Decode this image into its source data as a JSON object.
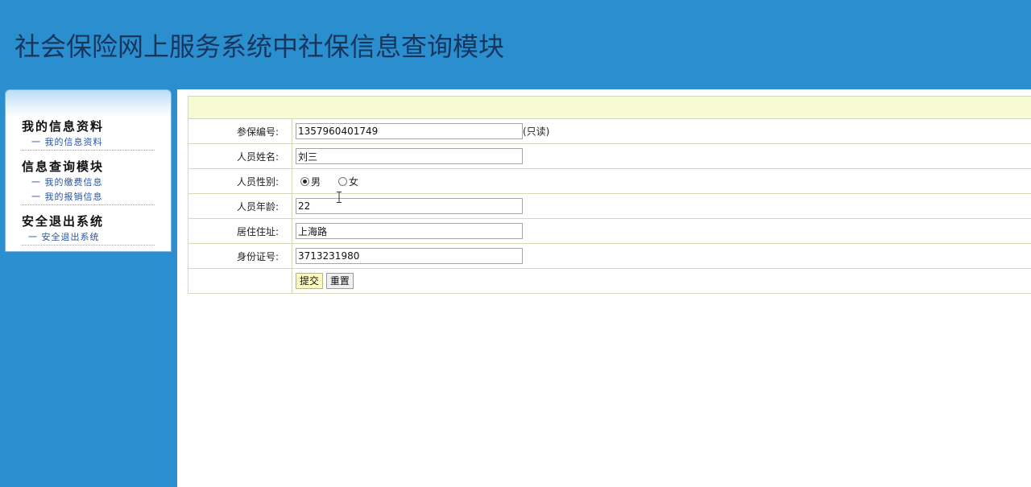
{
  "header": {
    "title": "社会保险网上服务系统中社保信息查询模块"
  },
  "sidebar": {
    "groups": [
      {
        "title": "我的信息资料",
        "items": [
          "一 我的信息资料"
        ]
      },
      {
        "title": "信息查询模块",
        "items": [
          "一 我的缴费信息",
          "一 我的报销信息"
        ]
      },
      {
        "title": "安全退出系统",
        "items": [
          "一 安全退出系统"
        ]
      }
    ]
  },
  "form": {
    "fields": {
      "insurance_no": {
        "label": "参保编号:",
        "value": "1357960401749",
        "note": "(只读)"
      },
      "name": {
        "label": "人员姓名:",
        "value": "刘三"
      },
      "gender": {
        "label": "人员性别:",
        "options": [
          "男",
          "女"
        ],
        "selected": "男"
      },
      "age": {
        "label": "人员年龄:",
        "value": "22"
      },
      "address": {
        "label": "居住住址:",
        "value": "上海路"
      },
      "id_no": {
        "label": "身份证号:",
        "value": "3713231980"
      }
    },
    "buttons": {
      "submit": "提交",
      "reset": "重置"
    }
  },
  "colors": {
    "page_bg": "#2a8ecf",
    "header_text": "#17365d",
    "form_header_bg": "#f7fbd3",
    "submit_bg": "#fcfabf",
    "menu_link": "#2955a0"
  }
}
